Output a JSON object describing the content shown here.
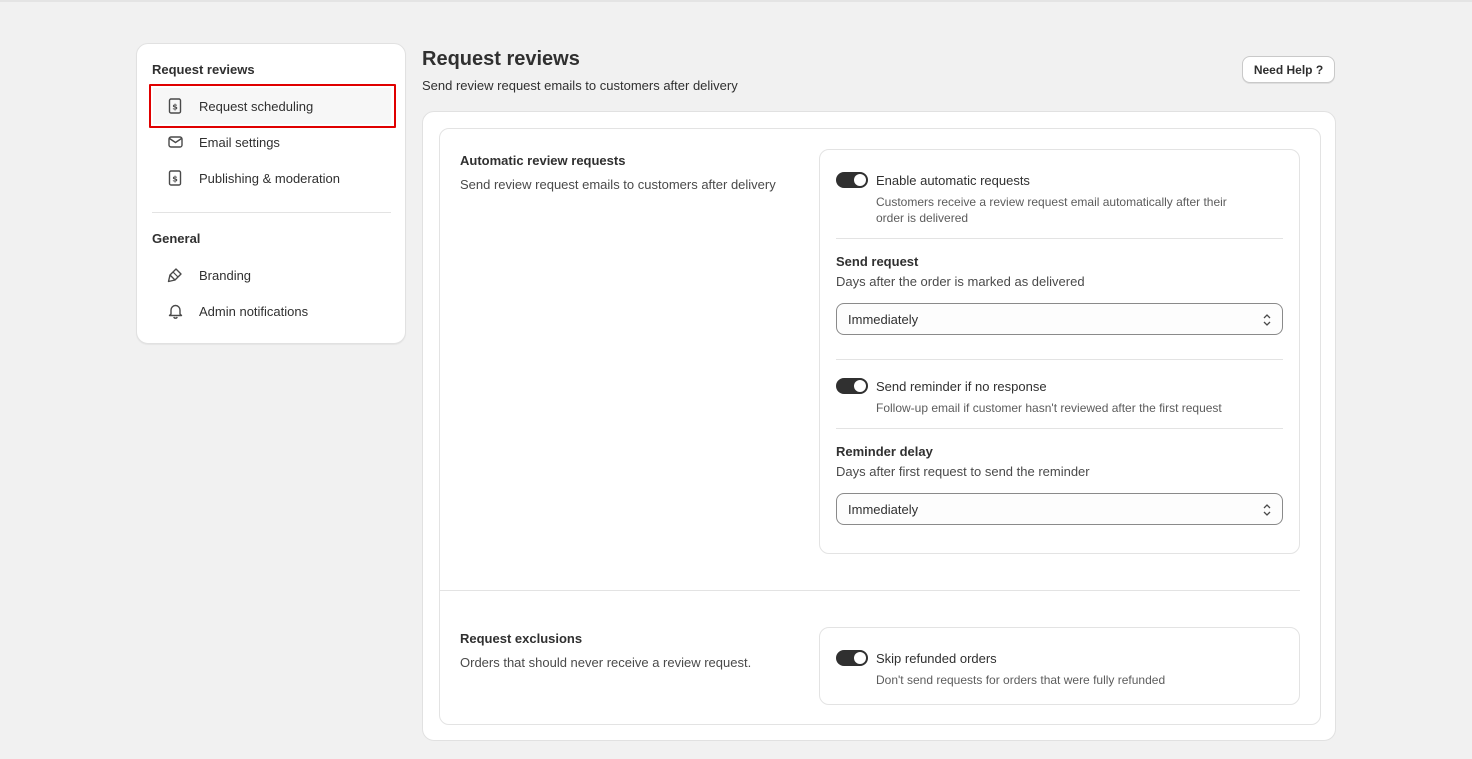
{
  "sidebar": {
    "group1_heading": "Request reviews",
    "group1_items": [
      {
        "label": "Request scheduling",
        "icon": "receipt-icon",
        "active": true
      },
      {
        "label": "Email settings",
        "icon": "email-icon"
      },
      {
        "label": "Publishing & moderation",
        "icon": "receipt-icon"
      }
    ],
    "group2_heading": "General",
    "group2_items": [
      {
        "label": "Branding",
        "icon": "paint-brush-icon"
      },
      {
        "label": "Admin notifications",
        "icon": "bell-icon"
      }
    ]
  },
  "header": {
    "title": "Request reviews",
    "subtitle": "Send review request emails to customers after delivery",
    "help_button": "Need Help ?"
  },
  "automatic": {
    "title": "Automatic review requests",
    "description": "Send review request emails to customers after delivery",
    "enable": {
      "label": "Enable automatic requests",
      "help_line1": "Customers receive a review request email automatically after their",
      "help_line2": "order is delivered",
      "on": true
    },
    "send_request": {
      "label": "Send request",
      "help": "Days after the order is marked as delivered",
      "value": "Immediately"
    },
    "reminder": {
      "label": "Send reminder if no response",
      "help": "Follow-up email if customer hasn't reviewed after the first request",
      "on": true
    },
    "reminder_delay": {
      "label": "Reminder delay",
      "help": "Days after first request to send the reminder",
      "value": "Immediately"
    }
  },
  "exclusions": {
    "title": "Request exclusions",
    "description": "Orders that should never receive a review request.",
    "skip_refunded": {
      "label": "Skip refunded orders",
      "help": "Don't send requests for orders that were fully refunded",
      "on": true
    }
  },
  "colors": {
    "highlight": "#e00000",
    "toggle_on": "#303030",
    "background": "#f1f1f1"
  }
}
